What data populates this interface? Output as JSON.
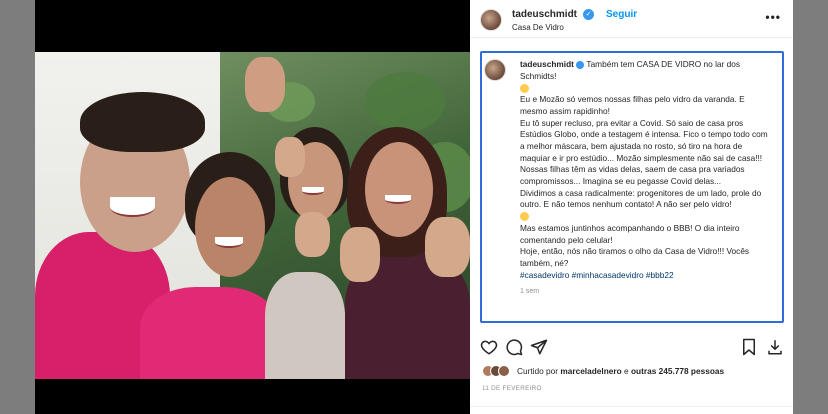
{
  "post": {
    "author": "tadeuschmidt",
    "follow_label": "Seguir",
    "separator": "•",
    "location": "Casa De Vidro",
    "more_label": "•••",
    "caption_lines": [
      "Também tem CASA DE VIDRO no lar dos Schmidts!",
      "Eu e Mozão só vemos nossas filhas pelo vidro da varanda. E mesmo assim rapidinho!",
      "Eu tô super recluso, pra evitar a Covid. Só saio de casa pros Estúdios Globo, onde a testagem é intensa. Fico o tempo todo com a melhor máscara, bem ajustada no rosto, só tiro na hora de maquiar e ir pro estúdio... Mozão simplesmente não sai de casa!!!",
      "Nossas filhas têm as vidas delas, saem de casa pra variados compromissos... Imagina se eu pegasse Covid delas...",
      "Dividimos a casa radicalmente: progenitores de um lado, prole do outro. E não temos nenhum contato! A não ser pelo vidro!",
      "Mas estamos juntinhos acompanhando o BBB! O dia inteiro comentando pelo celular!",
      "Hoje, então, nós não tiramos o olho da Casa de Vidro!!! Vocês também, né?"
    ],
    "hashtags": "#casadevidro #minhacasadevidro #bbb22",
    "caption_time": "1 sem",
    "liked_prefix": "Curtido por",
    "liked_user": "marceladelnero",
    "liked_connector": "e",
    "liked_count": "outras 245.778 pessoas",
    "date": "11 DE FEVEREIRO"
  },
  "colors": {
    "accent": "#0095f6",
    "highlight_border": "#2f6bd9",
    "verified": "#3897f0",
    "shirt_pink": "#d6206a"
  },
  "icons": {
    "verified": "verified-badge-icon",
    "like": "heart-icon",
    "comment": "comment-icon",
    "share": "paper-plane-icon",
    "save": "bookmark-icon",
    "download": "download-icon"
  }
}
